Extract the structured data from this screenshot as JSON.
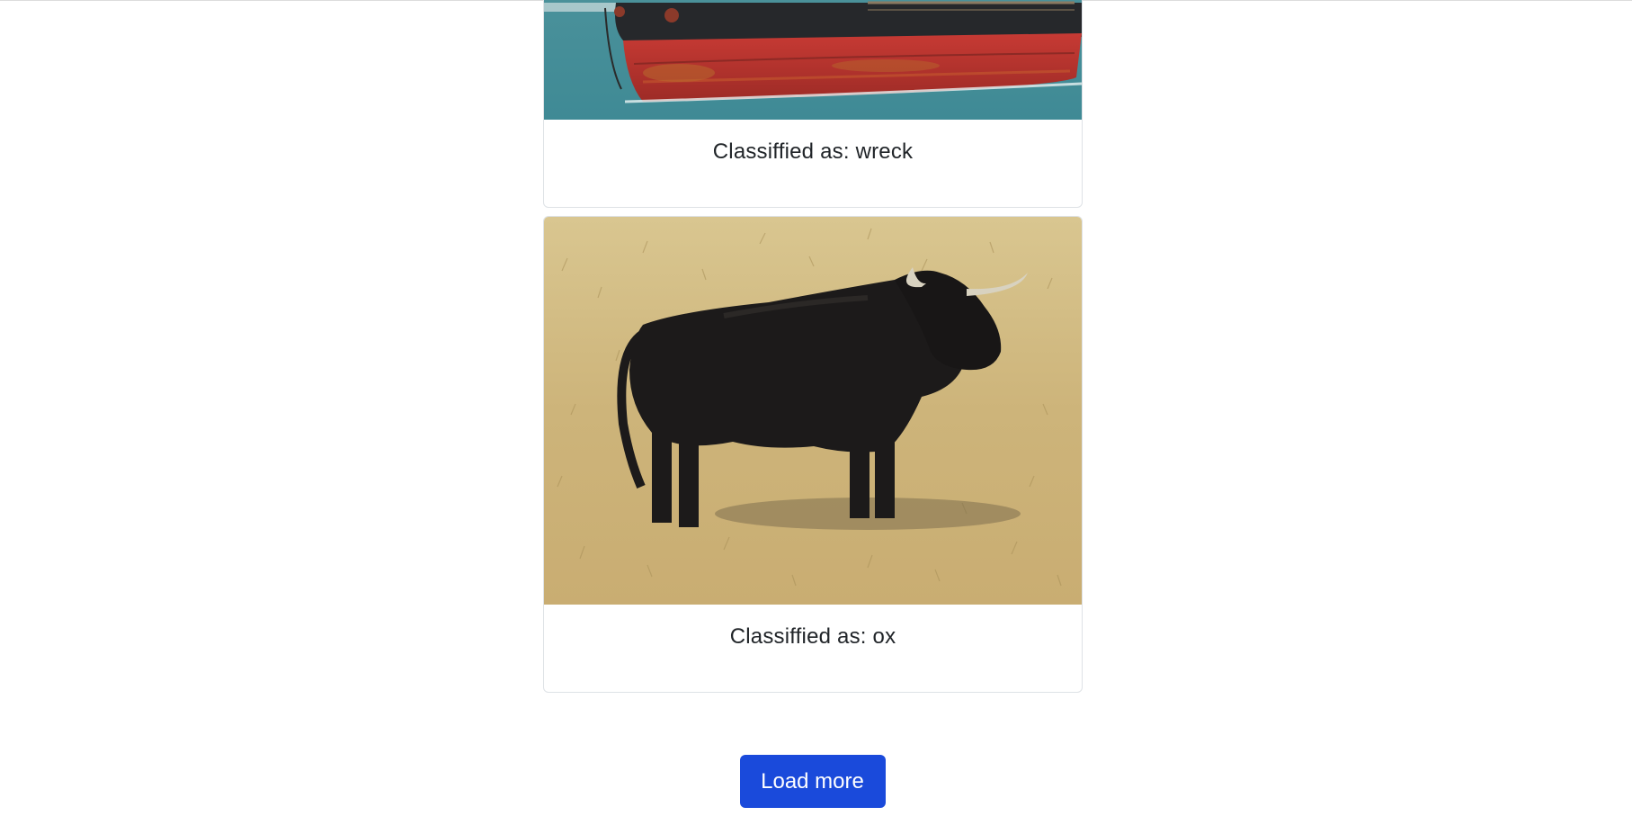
{
  "feed": {
    "items": [
      {
        "caption": "Classiffied as: wreck",
        "image": "ship-hull-photo"
      },
      {
        "caption": "Classiffied as: ox",
        "image": "black-bull-photo"
      }
    ]
  },
  "actions": {
    "load_more_label": "Load more",
    "button_color": "#1a4adb"
  }
}
